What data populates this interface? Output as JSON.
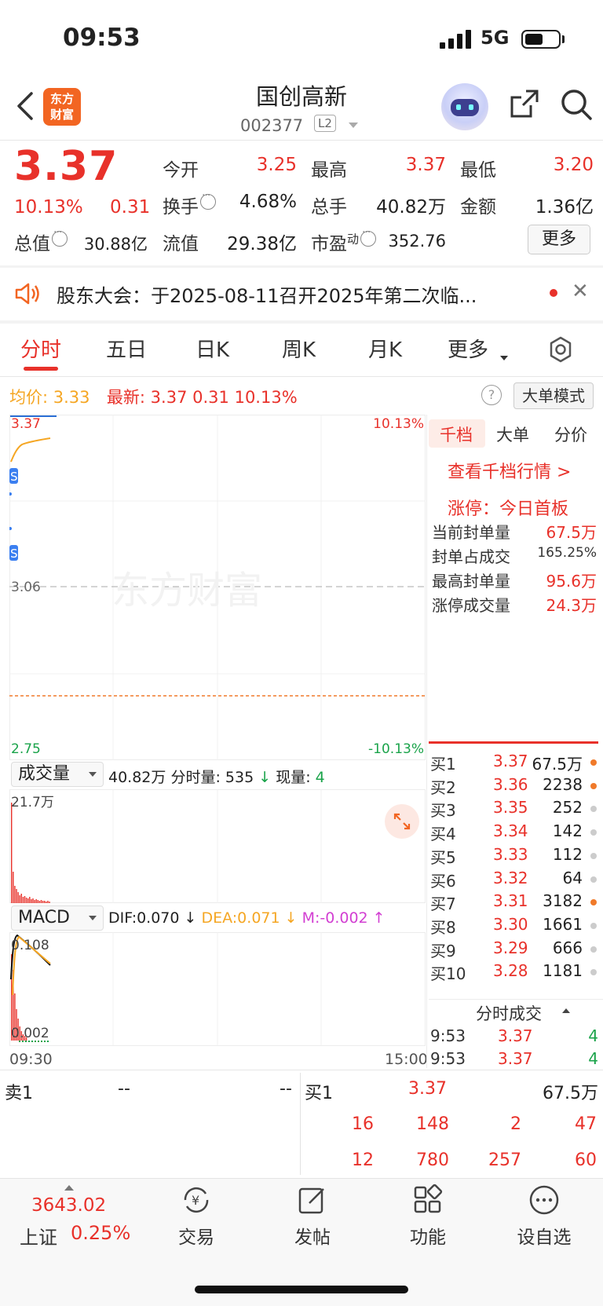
{
  "status_bar": {
    "time": "09:53",
    "network": "5G"
  },
  "header": {
    "logo_line1": "东方",
    "logo_line2": "财富",
    "stock_name": "国创高新",
    "stock_code": "002377",
    "level_badge": "L2"
  },
  "quote": {
    "price": "3.37",
    "change_pct": "10.13%",
    "change_amt": "0.31",
    "open_label": "今开",
    "open": "3.25",
    "high_label": "最高",
    "high": "3.37",
    "low_label": "最低",
    "low": "3.20",
    "turnover_label": "换手",
    "turnover": "4.68%",
    "volume_label": "总手",
    "volume": "40.82万",
    "amount_label": "金额",
    "amount": "1.36亿",
    "mktcap_label": "总值",
    "mktcap": "30.88亿",
    "float_label": "流值",
    "float_cap": "29.38亿",
    "pe_label": "市盈",
    "pe_sup": "动",
    "pe": "352.76",
    "more_button": "更多"
  },
  "notice": {
    "text": "股东大会：于2025-08-11召开2025年第二次临..."
  },
  "tabs": {
    "fenshi": "分时",
    "wuri": "五日",
    "rik": "日K",
    "zhouk": "周K",
    "yuek": "月K",
    "more": "更多"
  },
  "info_row": {
    "avg_label": "均价:",
    "avg": "3.33",
    "latest_label": "最新:",
    "latest": "3.37",
    "latest_chg": "0.31",
    "latest_pct": "10.13%",
    "help_icon_text": "?",
    "mode_button": "大单模式"
  },
  "main_chart": {
    "price_top": "3.37",
    "price_mid": "3.06",
    "price_bottom": "2.75",
    "pct_top": "10.13%",
    "pct_bottom": "-10.13%",
    "watermark": "东方财富",
    "badge": "S",
    "time_start": "09:30",
    "time_end": "15:00"
  },
  "volume_panel": {
    "selector": "成交量",
    "total": "40.82万",
    "tick_label": "分时量:",
    "tick_value": "535",
    "now_label": "现量:",
    "now_value": "4",
    "axis_top": "21.7万"
  },
  "macd_panel": {
    "selector": "MACD",
    "dif": "DIF:0.070",
    "dea": "DEA:0.071",
    "m": "M:-0.002",
    "axis_top": "0.108",
    "axis_bottom": "0.002"
  },
  "right_panel": {
    "tabs": [
      "千档",
      "大单",
      "分价"
    ],
    "link": "查看千档行情 >",
    "limit_title": "涨停：今日首板",
    "stats": [
      {
        "label": "当前封单量",
        "value": "67.5万"
      },
      {
        "label": "封单占成交",
        "value": "165.25%"
      },
      {
        "label": "最高封单量",
        "value": "95.6万"
      },
      {
        "label": "涨停成交量",
        "value": "24.3万"
      }
    ],
    "bids": [
      {
        "label": "买1",
        "price": "3.37",
        "vol": "67.5万",
        "hot": true
      },
      {
        "label": "买2",
        "price": "3.36",
        "vol": "2238",
        "hot": true
      },
      {
        "label": "买3",
        "price": "3.35",
        "vol": "252",
        "hot": false
      },
      {
        "label": "买4",
        "price": "3.34",
        "vol": "142",
        "hot": false
      },
      {
        "label": "买5",
        "price": "3.33",
        "vol": "112",
        "hot": false
      },
      {
        "label": "买6",
        "price": "3.32",
        "vol": "64",
        "hot": false
      },
      {
        "label": "买7",
        "price": "3.31",
        "vol": "3182",
        "hot": true
      },
      {
        "label": "买8",
        "price": "3.30",
        "vol": "1661",
        "hot": false
      },
      {
        "label": "买9",
        "price": "3.29",
        "vol": "666",
        "hot": false
      },
      {
        "label": "买10",
        "price": "3.28",
        "vol": "1181",
        "hot": false
      }
    ],
    "ticks_title": "分时成交",
    "ticks": [
      {
        "time": "9:53",
        "price": "3.37",
        "vol": "4"
      },
      {
        "time": "9:53",
        "price": "3.37",
        "vol": "4"
      }
    ]
  },
  "orderbook": {
    "sell_label": "卖1",
    "sell_price": "--",
    "sell_vol": "--",
    "buy_label": "买1",
    "buy_price": "3.37",
    "buy_vol": "67.5万",
    "row2": [
      "16",
      "148",
      "2",
      "47"
    ],
    "row3": [
      "12",
      "780",
      "257",
      "60"
    ]
  },
  "bottom_nav": {
    "index_value": "3643.02",
    "index_name": "上证",
    "index_pct": "0.25%",
    "trade": "交易",
    "post": "发帖",
    "function": "功能",
    "watchlist": "设自选"
  },
  "colors": {
    "up": "#e8312a",
    "down": "#1aa34a",
    "avg_line": "#f5a623",
    "brand": "#f26522"
  }
}
